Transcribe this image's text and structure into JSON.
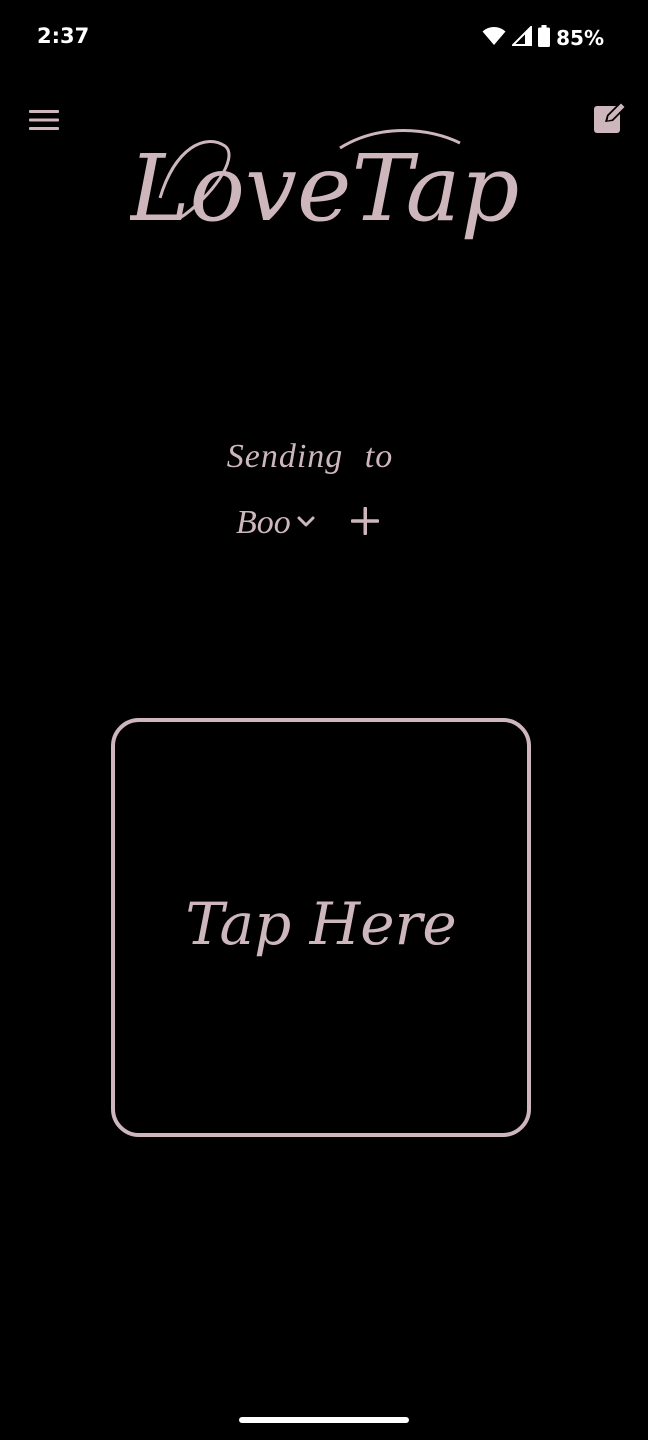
{
  "status_bar": {
    "time": "2:37",
    "battery": "85%"
  },
  "header": {
    "app_title": "LoveTap",
    "menu_icon": "hamburger-menu-icon",
    "edit_icon": "edit-square-icon"
  },
  "recipient": {
    "label": "Sending to",
    "selected_name": "Boo",
    "dropdown_icon": "chevron-down-icon",
    "add_icon": "plus-icon"
  },
  "tap_area": {
    "label": "Tap Here"
  },
  "colors": {
    "background": "#000000",
    "accent": "#cdb7bd",
    "status_text": "#ffffff"
  }
}
